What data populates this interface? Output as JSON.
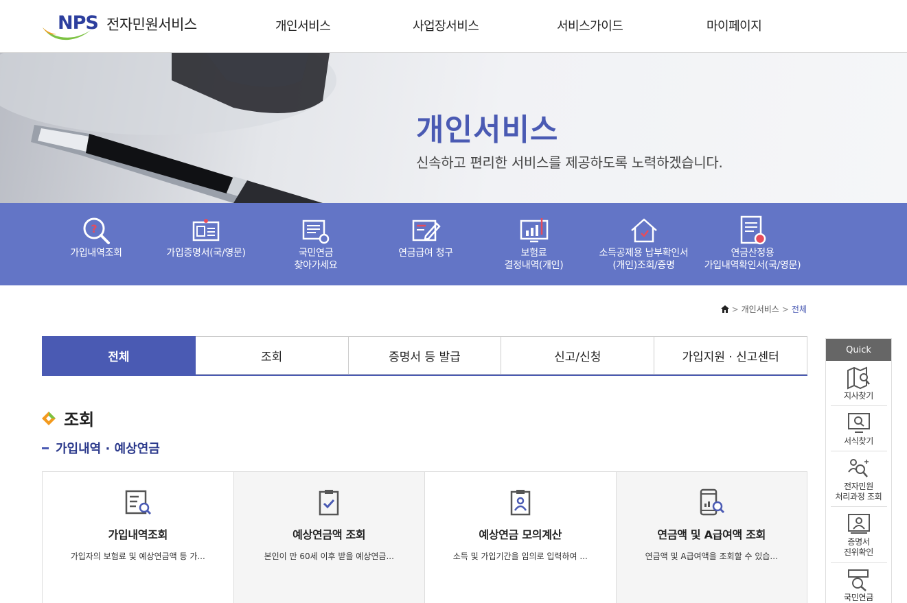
{
  "header": {
    "logo_text": "NPS",
    "site_name": "전자민원서비스",
    "nav": [
      "개인서비스",
      "사업장서비스",
      "서비스가이드",
      "마이페이지"
    ]
  },
  "banner": {
    "title": "개인서비스",
    "subtitle": "신속하고 편리한 서비스를 제공하도록 노력하겠습니다."
  },
  "quick_services": [
    {
      "label": "가입내역조회",
      "icon": "magnifier-question-icon"
    },
    {
      "label": "가입증명서(국/영문)",
      "icon": "id-card-icon"
    },
    {
      "label": "국민연금\n찾아가세요",
      "icon": "document-search-icon"
    },
    {
      "label": "연금급여 청구",
      "icon": "form-pen-icon"
    },
    {
      "label": "보험료\n결정내역(개인)",
      "icon": "monitor-chart-icon"
    },
    {
      "label": "소득공제용 납부확인서\n(개인)조회/증명",
      "icon": "house-icon"
    },
    {
      "label": "연금산정용\n가입내역확인서(국/영문)",
      "icon": "document-badge-icon"
    }
  ],
  "breadcrumb": {
    "level1": "개인서비스",
    "current": "전체"
  },
  "tabs": [
    {
      "label": "전체",
      "active": true
    },
    {
      "label": "조회",
      "active": false
    },
    {
      "label": "증명서 등 발급",
      "active": false
    },
    {
      "label": "신고/신청",
      "active": false
    },
    {
      "label": "가입지원 · 신고센터",
      "active": false
    }
  ],
  "section": {
    "title": "조회",
    "subtitle": "가입내역 · 예상연금"
  },
  "cards": [
    {
      "title": "가입내역조회",
      "desc": "가입자의 보험료 및 예상연금액 등 가...",
      "icon": "list-search-icon"
    },
    {
      "title": "예상연금액 조회",
      "desc": "본인이 만 60세 이후 받을 예상연금...",
      "icon": "clipboard-check-icon"
    },
    {
      "title": "예상연금 모의계산",
      "desc": "소득 및 가입기간을 임의로 입력하여 ...",
      "icon": "clipboard-person-icon"
    },
    {
      "title": "연금액 및 A급여액 조회",
      "desc": "연금액 및 A급여액을 조회할 수 있습...",
      "icon": "phone-search-icon"
    }
  ],
  "quick_panel": {
    "title": "Quick",
    "items": [
      {
        "label": "지사찾기",
        "icon": "map-search-icon"
      },
      {
        "label": "서식찾기",
        "icon": "monitor-search-icon"
      },
      {
        "label": "전자민원\n처리과정 조회",
        "icon": "people-search-icon"
      },
      {
        "label": "증명서\n진위확인",
        "icon": "certificate-icon"
      },
      {
        "label": "국민연금",
        "icon": "coin-search-icon"
      }
    ]
  },
  "colors": {
    "brand": "#4a5ab3",
    "service_bar": "#6375c6",
    "logo_blue": "#2d3f9e",
    "logo_green": "#7cc242",
    "logo_orange": "#f39a1e"
  }
}
